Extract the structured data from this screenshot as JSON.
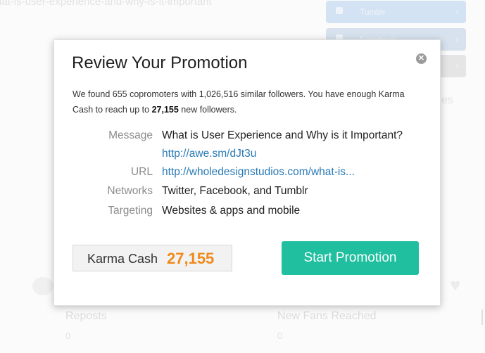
{
  "background": {
    "url_text": "hat-is-user-experience-and-why-is-it-important",
    "buttons": [
      {
        "label": "Tumblr",
        "color": "#d3e3f3"
      },
      {
        "label": "Facebook",
        "color": "#d7e2ee"
      },
      {
        "label": "",
        "color": "#e5e5e5"
      }
    ],
    "partial_text": "es",
    "stats": [
      {
        "label": "Reposts",
        "value": "0"
      },
      {
        "label": "New Fans Reached",
        "value": "0"
      }
    ]
  },
  "modal": {
    "title": "Review Your Promotion",
    "close_icon": "close-icon",
    "summary": {
      "part1": "We found 655 copromoters with 1,026,516 similar followers. You have enough Karma Cash to reach up to ",
      "highlight": "27,155",
      "part2": " new followers."
    },
    "details": {
      "message_label": "Message",
      "message_value": "What is User Experience and Why is it Important?",
      "message_link": "http://awe.sm/dJt3u",
      "url_label": "URL",
      "url_value": "http://wholedesignstudios.com/what-is...",
      "networks_label": "Networks",
      "networks_value": "Twitter, Facebook, and Tumblr",
      "targeting_label": "Targeting",
      "targeting_value": "Websites & apps and mobile"
    },
    "karma_cash": {
      "label": "Karma Cash",
      "value": "27,155"
    },
    "start_button_label": "Start Promotion"
  },
  "colors": {
    "accent_green": "#1fbf9f",
    "karma_orange": "#f08a1a",
    "link_blue": "#2a7ab5"
  }
}
